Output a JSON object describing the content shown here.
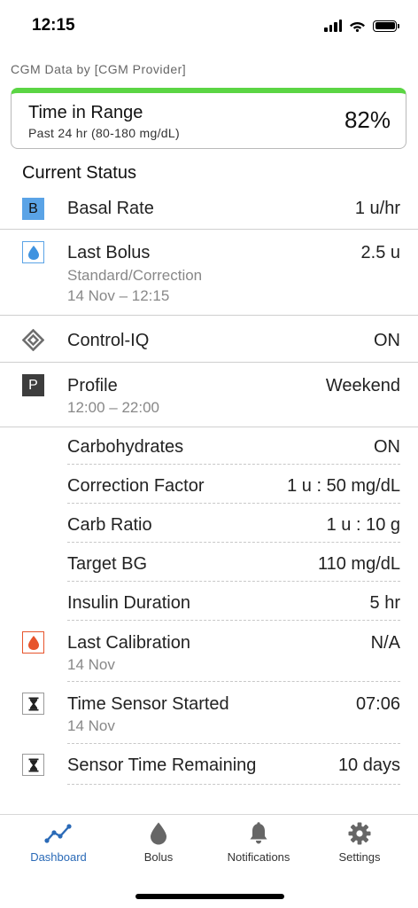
{
  "status_bar": {
    "time": "12:15"
  },
  "provider_label": "CGM Data by [CGM Provider]",
  "time_in_range": {
    "title": "Time in Range",
    "subtitle": "Past 24 hr (80-180 mg/dL)",
    "value": "82%",
    "percent": 82,
    "bar_color": "#5bd544"
  },
  "section_title": "Current Status",
  "basal": {
    "icon_letter": "B",
    "label": "Basal Rate",
    "value": "1 u/hr"
  },
  "last_bolus": {
    "label": "Last Bolus",
    "value": "2.5 u",
    "type": "Standard/Correction",
    "time": "14 Nov – 12:15"
  },
  "control_iq": {
    "label": "Control-IQ",
    "value": "ON"
  },
  "profile": {
    "icon_letter": "P",
    "label": "Profile",
    "value": "Weekend",
    "time": "12:00 – 22:00",
    "settings": [
      {
        "label": "Carbohydrates",
        "value": "ON"
      },
      {
        "label": "Correction Factor",
        "value": "1 u : 50 mg/dL"
      },
      {
        "label": "Carb Ratio",
        "value": "1 u : 10 g"
      },
      {
        "label": "Target BG",
        "value": "110 mg/dL"
      },
      {
        "label": "Insulin Duration",
        "value": "5 hr"
      }
    ]
  },
  "last_calibration": {
    "label": "Last Calibration",
    "value": "N/A",
    "date": "14 Nov"
  },
  "sensor_started": {
    "label": "Time Sensor Started",
    "value": "07:06",
    "date": "14 Nov"
  },
  "sensor_remaining": {
    "label": "Sensor Time Remaining",
    "value": "10 days"
  },
  "tabs": [
    {
      "label": "Dashboard",
      "icon": "chart-line-icon",
      "active": true
    },
    {
      "label": "Bolus",
      "icon": "droplet-icon",
      "active": false
    },
    {
      "label": "Notifications",
      "icon": "bell-icon",
      "active": false
    },
    {
      "label": "Settings",
      "icon": "gear-icon",
      "active": false
    }
  ],
  "colors": {
    "accent": "#2a6ab7",
    "in_range": "#5bd544",
    "basal_blue": "#5aa3e6",
    "calibration_red": "#e7542c"
  }
}
